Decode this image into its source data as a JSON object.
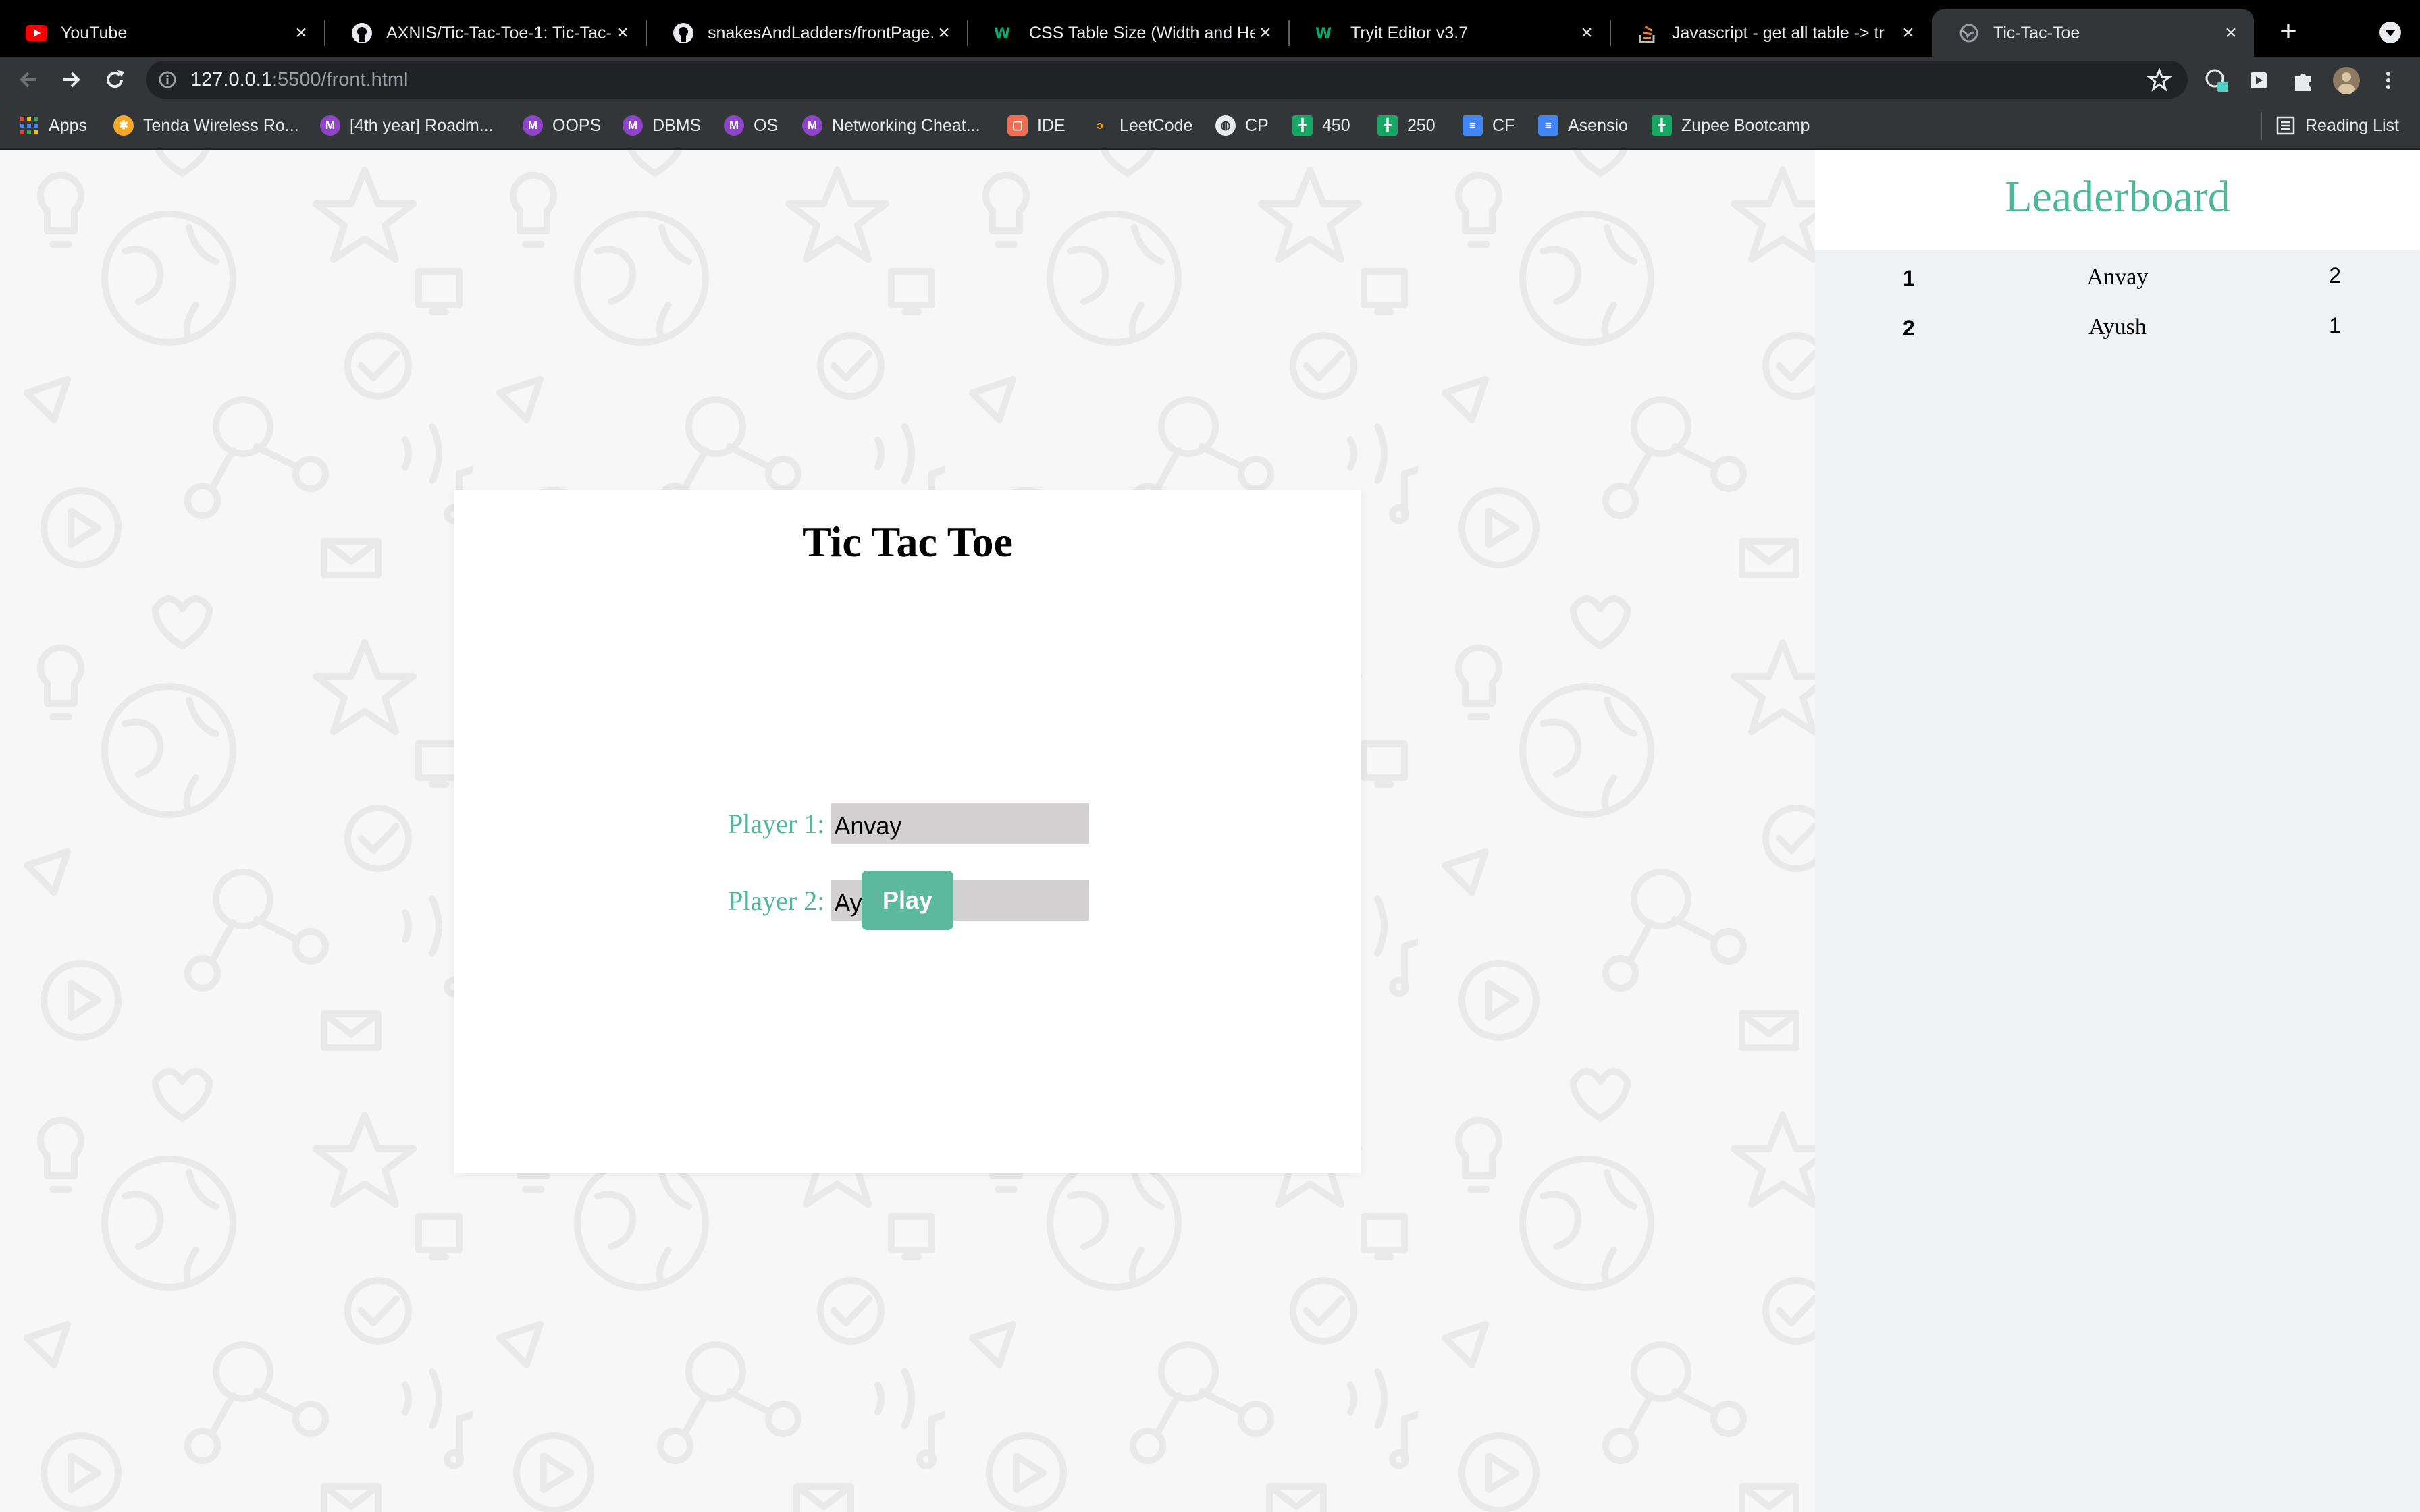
{
  "browser": {
    "tabs": [
      {
        "title": "YouTube",
        "icon": "youtube-icon",
        "active": false
      },
      {
        "title": "AXNIS/Tic-Tac-Toe-1: Tic-Tac-",
        "icon": "github-icon",
        "active": false
      },
      {
        "title": "snakesAndLadders/frontPage.",
        "icon": "github-icon",
        "active": false
      },
      {
        "title": "CSS Table Size (Width and He",
        "icon": "w3-icon",
        "active": false
      },
      {
        "title": "Tryit Editor v3.7",
        "icon": "w3-icon",
        "active": false
      },
      {
        "title": "Javascript - get all table -> tr",
        "icon": "stackoverflow-icon",
        "active": false
      },
      {
        "title": "Tic-Tac-Toe",
        "icon": "globe-icon",
        "active": true
      }
    ],
    "url": {
      "host": "127.0.0.1",
      "path": ":5500/front.html"
    },
    "bookmarks": [
      {
        "label": "Apps",
        "icon": "apps-grid-icon",
        "badge": ""
      },
      {
        "label": "Tenda Wireless Ro...",
        "icon": "tenda-icon",
        "badge": ""
      },
      {
        "label": "[4th year] Roadm...",
        "icon": "m-icon",
        "badge": "M"
      },
      {
        "label": "OOPS",
        "icon": "m-icon",
        "badge": "M"
      },
      {
        "label": "DBMS",
        "icon": "m-icon",
        "badge": "M"
      },
      {
        "label": "OS",
        "icon": "m-icon",
        "badge": "M"
      },
      {
        "label": "Networking Cheat...",
        "icon": "m-icon",
        "badge": "M"
      },
      {
        "label": "IDE",
        "icon": "ide-icon",
        "badge": ""
      },
      {
        "label": "LeetCode",
        "icon": "leetcode-icon",
        "badge": ""
      },
      {
        "label": "CP",
        "icon": "globe-icon",
        "badge": ""
      },
      {
        "label": "450",
        "icon": "sheets-icon",
        "badge": ""
      },
      {
        "label": "250",
        "icon": "sheets-icon",
        "badge": ""
      },
      {
        "label": "CF",
        "icon": "docs-icon",
        "badge": ""
      },
      {
        "label": "Asensio",
        "icon": "docs-icon",
        "badge": ""
      },
      {
        "label": "Zupee Bootcamp",
        "icon": "sheets-icon",
        "badge": ""
      }
    ],
    "reading_list": "Reading List"
  },
  "game": {
    "title": "Tic Tac Toe",
    "player1_label": "Player 1:",
    "player1_value": "Anvay",
    "player2_label": "Player 2:",
    "player2_value": "Ayush",
    "play_label": "Play"
  },
  "leaderboard": {
    "title": "Leaderboard",
    "rows": [
      {
        "rank": "1",
        "name": "Anvay",
        "score": "2"
      },
      {
        "rank": "2",
        "name": "Ayush",
        "score": "1"
      }
    ]
  },
  "colors": {
    "accent": "#4fb89a",
    "play_button": "#5cb99c",
    "input_bg": "#d3d1d2",
    "sidebar_bg": "#f0f1f3"
  }
}
